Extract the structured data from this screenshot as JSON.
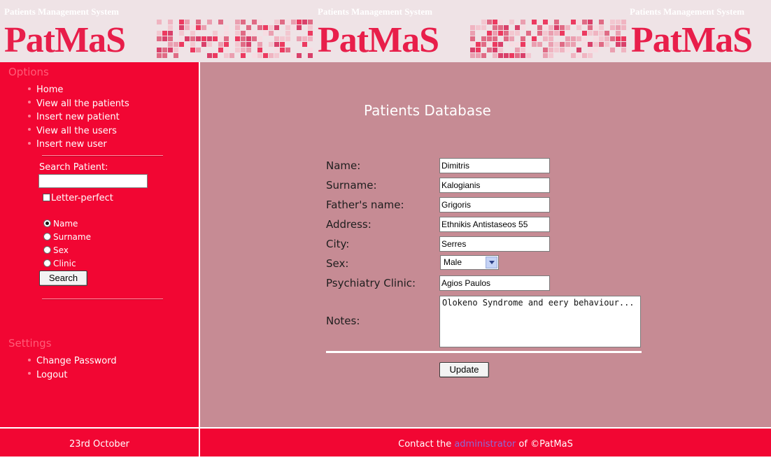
{
  "header": {
    "brand_small": "Patients Management System",
    "brand_big": "PatMaS"
  },
  "sidebar": {
    "options_title": "Options",
    "menu": [
      {
        "label": "Home"
      },
      {
        "label": "View all the patients"
      },
      {
        "label": "Insert new patient"
      },
      {
        "label": "View all the users"
      },
      {
        "label": "Insert new user"
      }
    ],
    "search": {
      "label": "Search Patient:",
      "value": "",
      "letter_perfect_label": "Letter-perfect",
      "options": [
        "Name",
        "Surname",
        "Sex",
        "Clinic"
      ],
      "selected": "Name",
      "button_label": "Search"
    },
    "settings_title": "Settings",
    "settings_menu": [
      {
        "label": "Change Password"
      },
      {
        "label": "Logout"
      }
    ]
  },
  "main": {
    "title": "Patients Database",
    "form": {
      "name_label": "Name:",
      "name_value": "Dimitris",
      "surname_label": "Surname:",
      "surname_value": "Kalogianis",
      "father_label": "Father's name:",
      "father_value": "Grigoris",
      "address_label": "Address:",
      "address_value": "Ethnikis Antistaseos 55",
      "city_label": "City:",
      "city_value": "Serres",
      "sex_label": "Sex:",
      "sex_value": "Male",
      "clinic_label": "Psychiatry Clinic:",
      "clinic_value": "Agios Paulos",
      "notes_label": "Notes:",
      "notes_value": "Olokeno Syndrome and eery behaviour..."
    },
    "update_label": "Update"
  },
  "footer": {
    "date": "23rd October",
    "contact_prefix": "Contact the",
    "contact_link": "administrator",
    "contact_suffix": "of ©PatMaS"
  },
  "colors": {
    "sidebar_bg": "#f20633",
    "main_bg": "#c68b94",
    "footer_bg": "#f20633",
    "brand_red": "#e81e4a"
  }
}
